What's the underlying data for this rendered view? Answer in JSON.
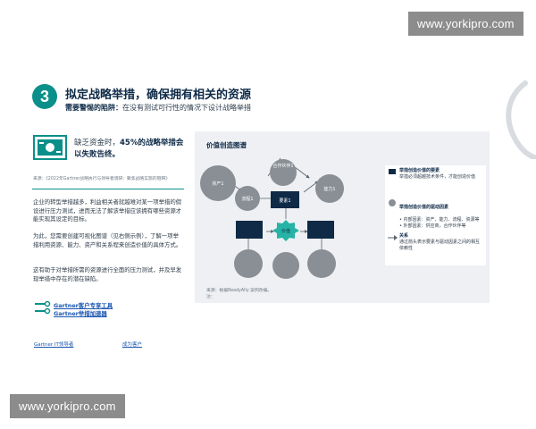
{
  "watermark_top": "www.yorkipro.com",
  "watermark_bottom": "www.yorkipro.com",
  "step": {
    "number": "3",
    "title": "拟定战略举措，确保拥有相关的资源",
    "subtitle_bold": "需要警惕的陷阱：",
    "subtitle_rest": "在没有测试可行性的情况下设计战略举措"
  },
  "stat": {
    "prefix": "缺乏资金时，",
    "highlight": "45%的战略举措会以失败告终。",
    "source": "来源：《2022年Gartner战略执行与领导者调研：聚焦战略实施的阻碍》"
  },
  "body": {
    "para1": "企业的转型举措越多，利益相关者就越难对某一项举措的假设进行压力测试，进而无法了解该举措应该拥有哪些资源才能实现其设定的目标。",
    "para2": "为此，您需要创建可视化图谱（见右侧示例），了解一项举措利用资源、能力、资产和关系程来创造价值的具体方式。",
    "para3": "这有助于对举措所需的资源进行全面的压力测试，并及早发现举措中存在的潜在缺陷。"
  },
  "links": {
    "tool": "Gartner客户专享工具",
    "webinar": "Gartner举措加速器"
  },
  "footer": {
    "link1": "Gartner IT领导者",
    "link2": "成为客户"
  },
  "diagram": {
    "title": "价值创造图谱",
    "source": "来源：根据ReadyAlly 案例改编。\n注：",
    "nodes": {
      "top": "合作伙伴1",
      "left": "资产1",
      "mid_left": "流程1",
      "right": "能力1",
      "center": "要素1",
      "value": "价值"
    },
    "legend": {
      "item1_title": "举措创造价值的要素",
      "item1_desc": "举措必须超越技术条件，才能创造价值",
      "item2_title": "举措创造价值的驱动因素",
      "item2_desc": "• 内部因素：资产、能力、流程、资源等\n• 外部因素：供应商，合作伙伴等",
      "item3_title": "关系",
      "item3_desc": "通过箭头表示要素与驱动因素之间的相互依赖性"
    },
    "colors": {
      "navy": "#0e2a47",
      "grey_node": "#8a8f95",
      "teal": "#27b3a6"
    }
  }
}
